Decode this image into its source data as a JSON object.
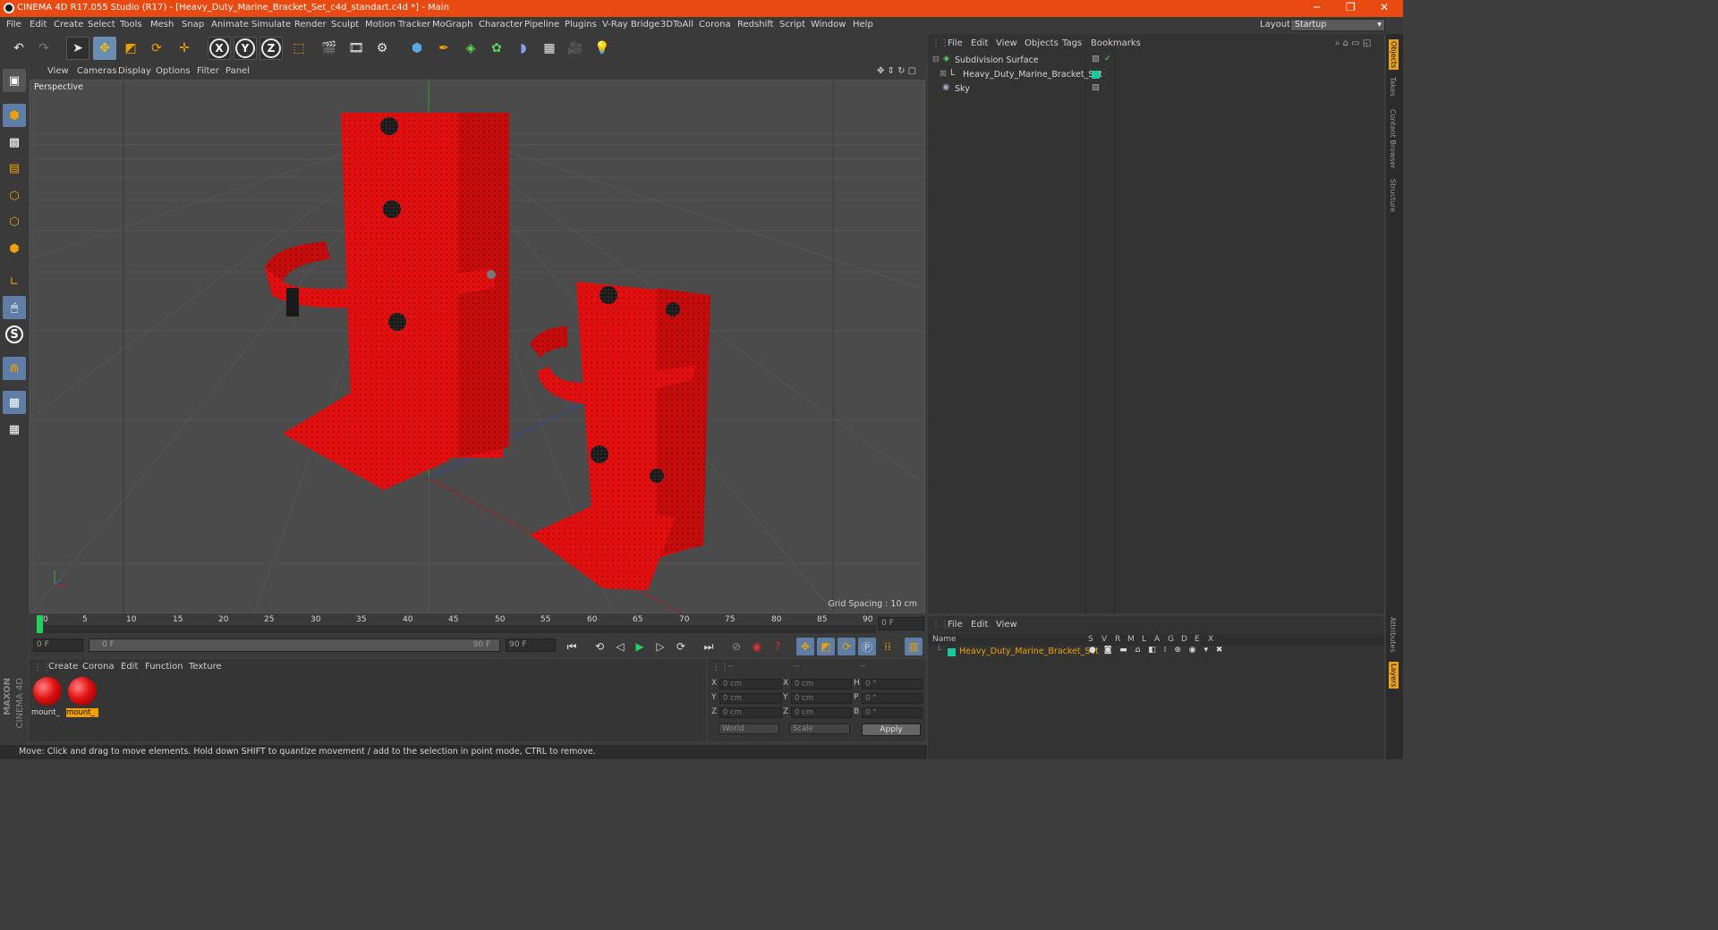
{
  "window": {
    "title": "CINEMA 4D R17.055 Studio (R17) - [Heavy_Duty_Marine_Bracket_Set_c4d_standart.c4d *] - Main"
  },
  "menu": [
    "File",
    "Edit",
    "Create",
    "Select",
    "Tools",
    "Mesh",
    "Snap",
    "Animate",
    "Simulate",
    "Render",
    "Sculpt",
    "Motion Tracker",
    "MoGraph",
    "Character",
    "Pipeline",
    "Plugins",
    "V-Ray Bridge",
    "3DToAll",
    "Corona",
    "Redshift",
    "Script",
    "Window",
    "Help"
  ],
  "layout": {
    "label": "Layout:",
    "value": "Startup"
  },
  "toolbar": {
    "axis_x": "X",
    "axis_y": "Y",
    "axis_z": "Z"
  },
  "viewport": {
    "menu": [
      "View",
      "Cameras",
      "Display",
      "Options",
      "Filter",
      "Panel"
    ],
    "label": "Perspective",
    "grid_spacing": "Grid Spacing : 10 cm"
  },
  "object_manager": {
    "menu": [
      "File",
      "Edit",
      "View",
      "Objects",
      "Tags",
      "Bookmarks"
    ],
    "objects": [
      {
        "name": "Subdivision Surface"
      },
      {
        "name": "Heavy_Duty_Marine_Bracket_Set"
      },
      {
        "name": "Sky"
      }
    ]
  },
  "right_tabs": [
    "Objects",
    "Takes",
    "Content Browser",
    "Structure",
    "Attributes",
    "Layers"
  ],
  "timeline": {
    "ticks": [
      "0",
      "5",
      "10",
      "15",
      "20",
      "25",
      "30",
      "35",
      "40",
      "45",
      "50",
      "55",
      "60",
      "65",
      "70",
      "75",
      "80",
      "85",
      "90"
    ],
    "current_frame": "0 F",
    "start": "0 F",
    "range_start": "0 F",
    "range_end": "90 F",
    "end": "90 F"
  },
  "material_manager": {
    "menu": [
      "Create",
      "Corona",
      "Edit",
      "Function",
      "Texture"
    ],
    "materials": [
      {
        "name": "mount_"
      },
      {
        "name": "mount_"
      }
    ]
  },
  "coordinates": {
    "header": [
      "--",
      "--",
      "--"
    ],
    "rows": [
      {
        "a": "X",
        "av": "0 cm",
        "b": "X",
        "bv": "0 cm",
        "c": "H",
        "cv": "0 °"
      },
      {
        "a": "Y",
        "av": "0 cm",
        "b": "Y",
        "bv": "0 cm",
        "c": "P",
        "cv": "0 °"
      },
      {
        "a": "Z",
        "av": "0 cm",
        "b": "Z",
        "bv": "0 cm",
        "c": "B",
        "cv": "0 °"
      }
    ],
    "space": "World",
    "mode": "Scale",
    "apply": "Apply"
  },
  "layer_manager": {
    "menu": [
      "File",
      "Edit",
      "View"
    ],
    "columns": [
      "Name",
      "S",
      "V",
      "R",
      "M",
      "L",
      "A",
      "G",
      "D",
      "E",
      "X"
    ],
    "rows": [
      {
        "name": "Heavy_Duty_Marine_Bracket_Set"
      }
    ]
  },
  "brand": {
    "maxon": "MAXON",
    "product": "CINEMA 4D"
  },
  "status": "Move: Click and drag to move elements. Hold down SHIFT to quantize movement / add to the selection in point mode, CTRL to remove.",
  "colors": {
    "titlebar": "#e84a12",
    "object_red": "#e01010",
    "selection_blue": "#6a8db5",
    "highlight_orange": "#f0a000"
  }
}
